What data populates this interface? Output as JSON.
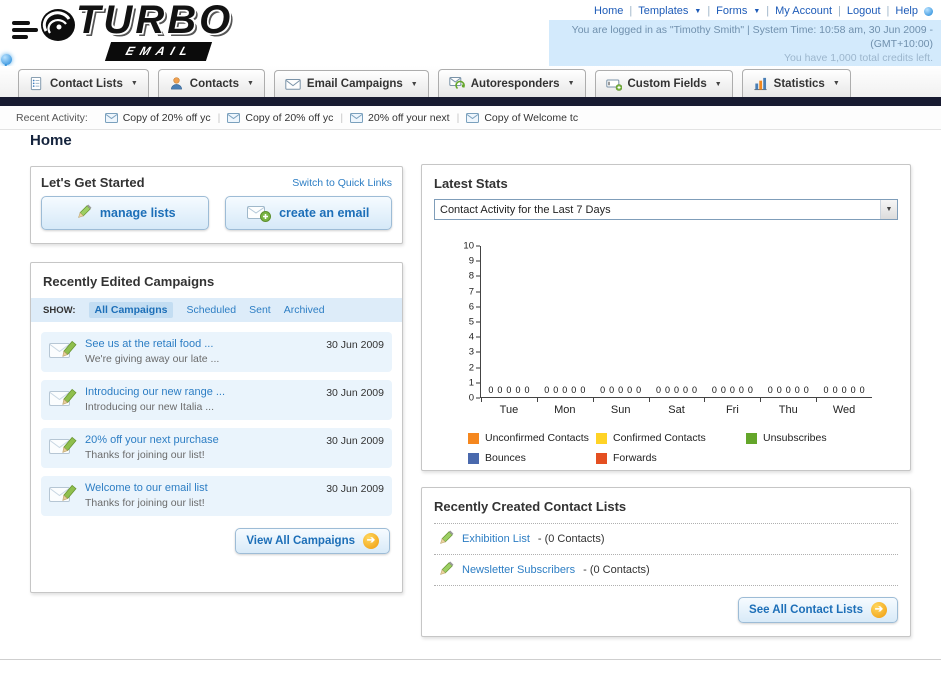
{
  "header": {
    "logo": {
      "main": "TURBO",
      "sub": "EMAIL"
    },
    "nav_links": [
      "Home",
      "Templates",
      "Forms",
      "My Account",
      "Logout",
      "Help"
    ],
    "login_line": "You are logged in as \"Timothy Smith\" | System Time: 10:58 am, 30 Jun 2009 - (GMT+10:00)",
    "credits_line": "You have 1,000 total credits left."
  },
  "main_nav": {
    "items": [
      {
        "label": "Contact Lists"
      },
      {
        "label": "Contacts"
      },
      {
        "label": "Email Campaigns"
      },
      {
        "label": "Autoresponders"
      },
      {
        "label": "Custom Fields"
      },
      {
        "label": "Statistics"
      }
    ]
  },
  "recent_activity": {
    "label": "Recent Activity:",
    "items": [
      "Copy of 20% off yc",
      "Copy of 20% off yc",
      "20% off your next",
      "Copy of Welcome tc"
    ]
  },
  "page": {
    "title": "Home"
  },
  "get_started": {
    "title": "Let's Get Started",
    "switch_link": "Switch to Quick Links",
    "manage_lists_label": "manage lists",
    "create_email_label": "create an email"
  },
  "campaigns": {
    "title": "Recently Edited Campaigns",
    "show_label": "SHOW:",
    "filters": [
      "All Campaigns",
      "Scheduled",
      "Sent",
      "Archived"
    ],
    "active_filter": "All Campaigns",
    "items": [
      {
        "title": "See us at the retail food ...",
        "subtitle": "We're giving away our late ...",
        "date": "30 Jun 2009"
      },
      {
        "title": "Introducing our new range ...",
        "subtitle": "Introducing our new Italia ...",
        "date": "30 Jun 2009"
      },
      {
        "title": "20% off your next purchase",
        "subtitle": "Thanks for joining our list!",
        "date": "30 Jun 2009"
      },
      {
        "title": "Welcome to our email list",
        "subtitle": "Thanks for joining our list!",
        "date": "30 Jun 2009"
      }
    ],
    "view_all_label": "View All Campaigns"
  },
  "stats": {
    "title": "Latest Stats",
    "dropdown_value": "Contact Activity for the Last 7 Days",
    "chart_data": {
      "type": "bar",
      "categories": [
        "Tue",
        "Mon",
        "Sun",
        "Sat",
        "Fri",
        "Thu",
        "Wed"
      ],
      "series": [
        {
          "name": "Unconfirmed Contacts",
          "color": "#f5871e",
          "values": [
            0,
            0,
            0,
            0,
            0,
            0,
            0
          ]
        },
        {
          "name": "Confirmed Contacts",
          "color": "#ffd326",
          "values": [
            0,
            0,
            0,
            0,
            0,
            0,
            0
          ]
        },
        {
          "name": "Unsubscribes",
          "color": "#64a62a",
          "values": [
            0,
            0,
            0,
            0,
            0,
            0,
            0
          ]
        },
        {
          "name": "Bounces",
          "color": "#4a69ad",
          "values": [
            0,
            0,
            0,
            0,
            0,
            0,
            0
          ]
        },
        {
          "name": "Forwards",
          "color": "#e44f21",
          "values": [
            0,
            0,
            0,
            0,
            0,
            0,
            0
          ]
        }
      ],
      "ylim": [
        0,
        10
      ],
      "yticks": [
        0,
        1,
        2,
        3,
        4,
        5,
        6,
        7,
        8,
        9,
        10
      ],
      "grid": false,
      "legend_position": "bottom"
    }
  },
  "contact_lists": {
    "title": "Recently Created Contact Lists",
    "items": [
      {
        "name": "Exhibition List",
        "detail": "- (0 Contacts)"
      },
      {
        "name": "Newsletter Subscribers",
        "detail": "- (0 Contacts)"
      }
    ],
    "see_all_label": "See All Contact Lists"
  },
  "colors": {
    "accent_blue": "#2d7ec4",
    "dark_bar": "#181b31",
    "row_bg": "#eaf4fc",
    "login_strip_bg": "#d3eafc"
  }
}
